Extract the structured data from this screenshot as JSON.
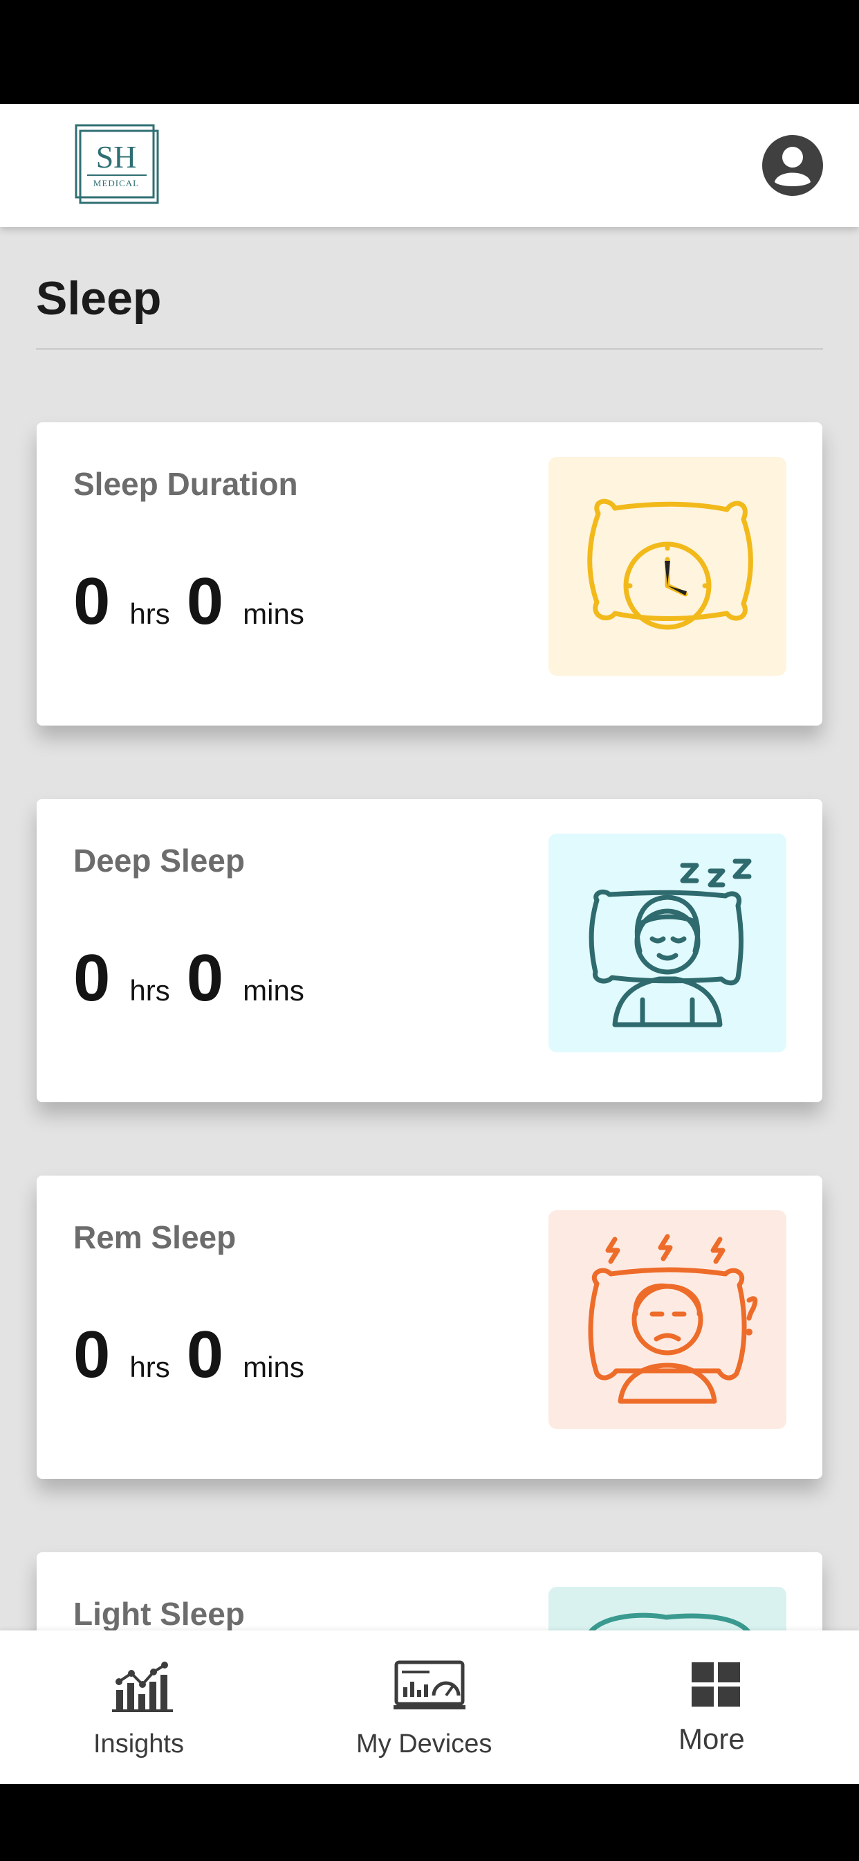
{
  "header": {
    "logo_text": "SH",
    "logo_subtext": "MEDICAL"
  },
  "page": {
    "title": "Sleep"
  },
  "cards": [
    {
      "title": "Sleep Duration",
      "hours": "0",
      "hours_unit": "hrs",
      "minutes": "0",
      "minutes_unit": "mins",
      "icon": "pillow-clock-icon",
      "icon_bg": "#fff4de",
      "icon_color": "#f2b91a"
    },
    {
      "title": "Deep Sleep",
      "hours": "0",
      "hours_unit": "hrs",
      "minutes": "0",
      "minutes_unit": "mins",
      "icon": "sleeping-person-icon",
      "icon_bg": "#e1fafd",
      "icon_color": "#2f6b6e"
    },
    {
      "title": "Rem Sleep",
      "hours": "0",
      "hours_unit": "hrs",
      "minutes": "0",
      "minutes_unit": "mins",
      "icon": "restless-sleeper-icon",
      "icon_bg": "#fdebe3",
      "icon_color": "#ee6c2a"
    },
    {
      "title": "Light Sleep",
      "icon": "light-sleep-icon",
      "icon_bg": "#d9f2f0",
      "icon_color": "#3a9a8f"
    }
  ],
  "nav": {
    "items": [
      {
        "label": "Insights",
        "icon": "bar-chart-icon"
      },
      {
        "label": "My Devices",
        "icon": "monitor-gauge-icon"
      },
      {
        "label": "More",
        "icon": "grid-icon"
      }
    ]
  },
  "colors": {
    "page_bg": "#e3e3e3",
    "logo_teal": "#2f6f73",
    "avatar": "#404040"
  }
}
